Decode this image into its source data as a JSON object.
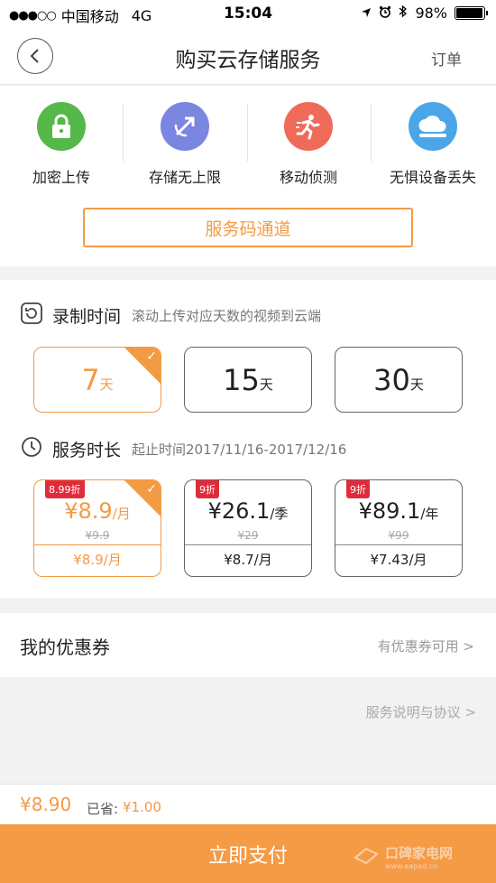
{
  "status_bar": {
    "carrier": "中国移动",
    "network": "4G",
    "time": "15:04",
    "battery": "98%"
  },
  "nav": {
    "title": "购买云存储服务",
    "orders_label": "订单"
  },
  "features": [
    {
      "label": "加密上传",
      "icon": "lock-icon",
      "color": "#55b848"
    },
    {
      "label": "存储无上限",
      "icon": "arrow-orbit-icon",
      "color": "#7a86e0"
    },
    {
      "label": "移动侦测",
      "icon": "running-person-icon",
      "color": "#f06a5a"
    },
    {
      "label": "无惧设备丢失",
      "icon": "cloud-icon",
      "color": "#4ba6e8"
    }
  ],
  "service_code_label": "服务码通道",
  "recording": {
    "title": "录制时间",
    "subtitle": "滚动上传对应天数的视频到云端",
    "options": [
      {
        "value": "7",
        "unit": "天",
        "selected": true
      },
      {
        "value": "15",
        "unit": "天",
        "selected": false
      },
      {
        "value": "30",
        "unit": "天",
        "selected": false
      }
    ]
  },
  "duration": {
    "title": "服务时长",
    "subtitle": "起止时间2017/11/16-2017/12/16",
    "options": [
      {
        "discount": "8.99折",
        "price": "¥8.9",
        "unit": "/月",
        "original": "¥9.9",
        "monthly": "¥8.9/月",
        "selected": true
      },
      {
        "discount": "9折",
        "price": "¥26.1",
        "unit": "/季",
        "original": "¥29",
        "monthly": "¥8.7/月",
        "selected": false
      },
      {
        "discount": "9折",
        "price": "¥89.1",
        "unit": "/年",
        "original": "¥99",
        "monthly": "¥7.43/月",
        "selected": false
      }
    ]
  },
  "coupon": {
    "label": "我的优惠券",
    "link": "有优惠券可用 >"
  },
  "terms_link": "服务说明与协议 >",
  "summary": {
    "total": "¥8.90",
    "saved_label": "已省:",
    "saved_value": "¥1.00"
  },
  "pay_button": "立即支付",
  "watermark": {
    "text": "口碑家电网",
    "url": "www.eapad.cn"
  },
  "colors": {
    "accent": "#f39a44",
    "discount_badge": "#e02c3a"
  }
}
